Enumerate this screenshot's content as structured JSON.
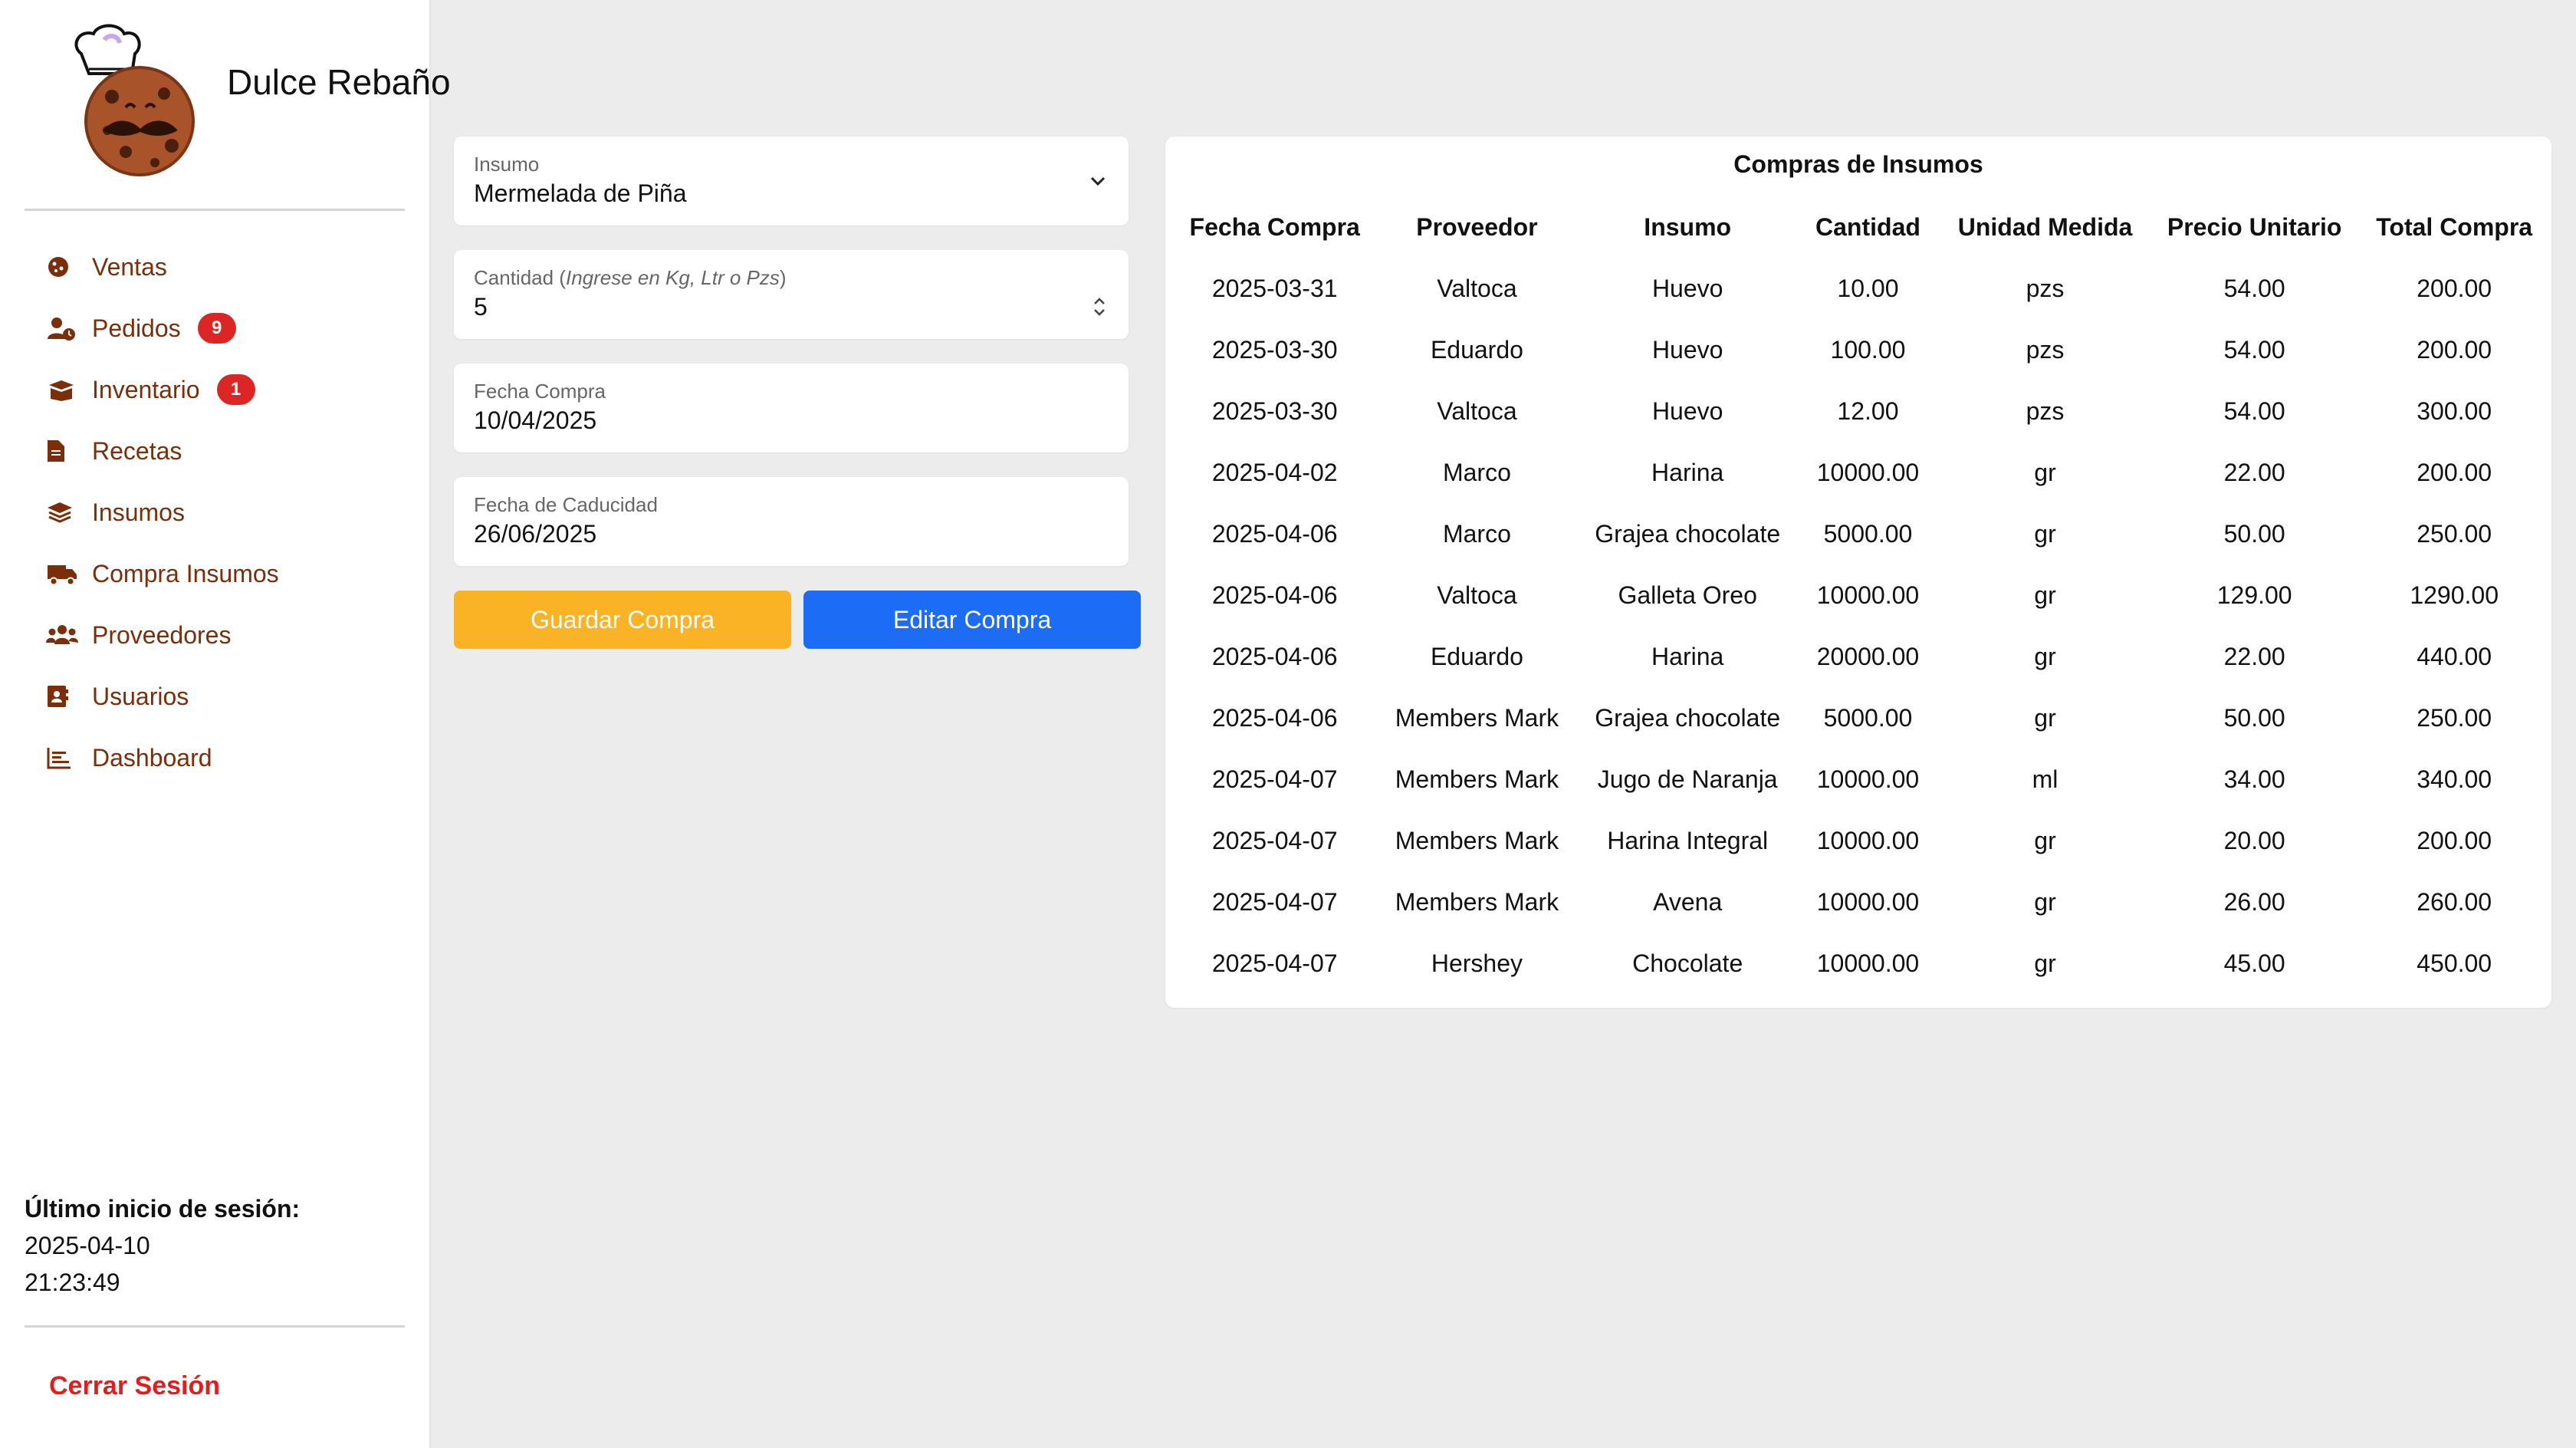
{
  "brand": {
    "name": "Dulce Rebaño"
  },
  "sidebar": {
    "items": [
      {
        "label": "Ventas",
        "icon": "cookie-icon"
      },
      {
        "label": "Pedidos",
        "icon": "user-clock-icon",
        "badge": "9"
      },
      {
        "label": "Inventario",
        "icon": "box-open-icon",
        "badge": "1"
      },
      {
        "label": "Recetas",
        "icon": "file-icon"
      },
      {
        "label": "Insumos",
        "icon": "layers-icon"
      },
      {
        "label": "Compra Insumos",
        "icon": "truck-icon"
      },
      {
        "label": "Proveedores",
        "icon": "users-icon"
      },
      {
        "label": "Usuarios",
        "icon": "address-book-icon"
      },
      {
        "label": "Dashboard",
        "icon": "chart-icon"
      }
    ],
    "accent_color": "#7a2e0a",
    "badge_color": "#dc2626"
  },
  "session": {
    "title": "Último inicio de sesión:",
    "date": "2025-04-10",
    "time": "21:23:49",
    "logout_label": "Cerrar Sesión"
  },
  "form": {
    "insumo": {
      "label": "Insumo",
      "value": "Mermelada de Piña"
    },
    "cantidad": {
      "label": "Cantidad",
      "hint": "Ingrese en Kg, Ltr o Pzs",
      "value": "5"
    },
    "fecha_compra": {
      "label": "Fecha Compra",
      "value": "10/04/2025"
    },
    "fecha_caducidad": {
      "label": "Fecha de Caducidad",
      "value": "26/06/2025"
    },
    "save_label": "Guardar Compra",
    "edit_label": "Editar Compra",
    "save_color": "#fbb326",
    "edit_color": "#1d6cf5"
  },
  "table": {
    "title": "Compras de Insumos",
    "headers": [
      "Fecha Compra",
      "Proveedor",
      "Insumo",
      "Cantidad",
      "Unidad Medida",
      "Precio Unitario",
      "Total Compra"
    ],
    "rows": [
      [
        "2025-03-31",
        "Valtoca",
        "Huevo",
        "10.00",
        "pzs",
        "54.00",
        "200.00"
      ],
      [
        "2025-03-30",
        "Eduardo",
        "Huevo",
        "100.00",
        "pzs",
        "54.00",
        "200.00"
      ],
      [
        "2025-03-30",
        "Valtoca",
        "Huevo",
        "12.00",
        "pzs",
        "54.00",
        "300.00"
      ],
      [
        "2025-04-02",
        "Marco",
        "Harina",
        "10000.00",
        "gr",
        "22.00",
        "200.00"
      ],
      [
        "2025-04-06",
        "Marco",
        "Grajea chocolate",
        "5000.00",
        "gr",
        "50.00",
        "250.00"
      ],
      [
        "2025-04-06",
        "Valtoca",
        "Galleta Oreo",
        "10000.00",
        "gr",
        "129.00",
        "1290.00"
      ],
      [
        "2025-04-06",
        "Eduardo",
        "Harina",
        "20000.00",
        "gr",
        "22.00",
        "440.00"
      ],
      [
        "2025-04-06",
        "Members Mark",
        "Grajea chocolate",
        "5000.00",
        "gr",
        "50.00",
        "250.00"
      ],
      [
        "2025-04-07",
        "Members Mark",
        "Jugo de Naranja",
        "10000.00",
        "ml",
        "34.00",
        "340.00"
      ],
      [
        "2025-04-07",
        "Members Mark",
        "Harina Integral",
        "10000.00",
        "gr",
        "20.00",
        "200.00"
      ],
      [
        "2025-04-07",
        "Members Mark",
        "Avena",
        "10000.00",
        "gr",
        "26.00",
        "260.00"
      ],
      [
        "2025-04-07",
        "Hershey",
        "Chocolate",
        "10000.00",
        "gr",
        "45.00",
        "450.00"
      ]
    ]
  }
}
